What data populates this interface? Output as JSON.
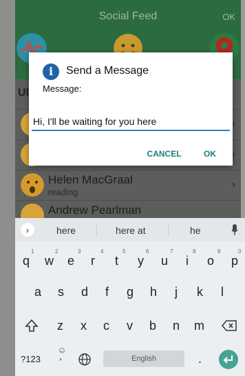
{
  "app": {
    "title": "Social Feed",
    "ok": "OK",
    "list_header": "Ul",
    "rows": [
      {
        "name": "Helen MacGraal",
        "sub": "reading"
      },
      {
        "name": "Andrew Pearlman",
        "sub": ""
      }
    ]
  },
  "dialog": {
    "title": "Send a Message",
    "label": "Message:",
    "value": "Hi, I'll be waiting for you here",
    "cancel": "CANCEL",
    "ok": "OK"
  },
  "keyboard": {
    "suggestions": [
      "here",
      "here at",
      "he"
    ],
    "row1": [
      "q",
      "w",
      "e",
      "r",
      "t",
      "y",
      "u",
      "i",
      "o",
      "p"
    ],
    "row1_nums": [
      "1",
      "2",
      "3",
      "4",
      "5",
      "6",
      "7",
      "8",
      "9",
      "0"
    ],
    "row2": [
      "a",
      "s",
      "d",
      "f",
      "g",
      "h",
      "j",
      "k",
      "l"
    ],
    "row3": [
      "z",
      "x",
      "c",
      "v",
      "b",
      "n",
      "m"
    ],
    "mode_key": "?123",
    "space_label": "English",
    "comma": ",",
    "period": "."
  },
  "colors": {
    "accent_blue": "#2b7fc8",
    "button_teal": "#1f7c7a",
    "enter_green": "#46a393"
  }
}
